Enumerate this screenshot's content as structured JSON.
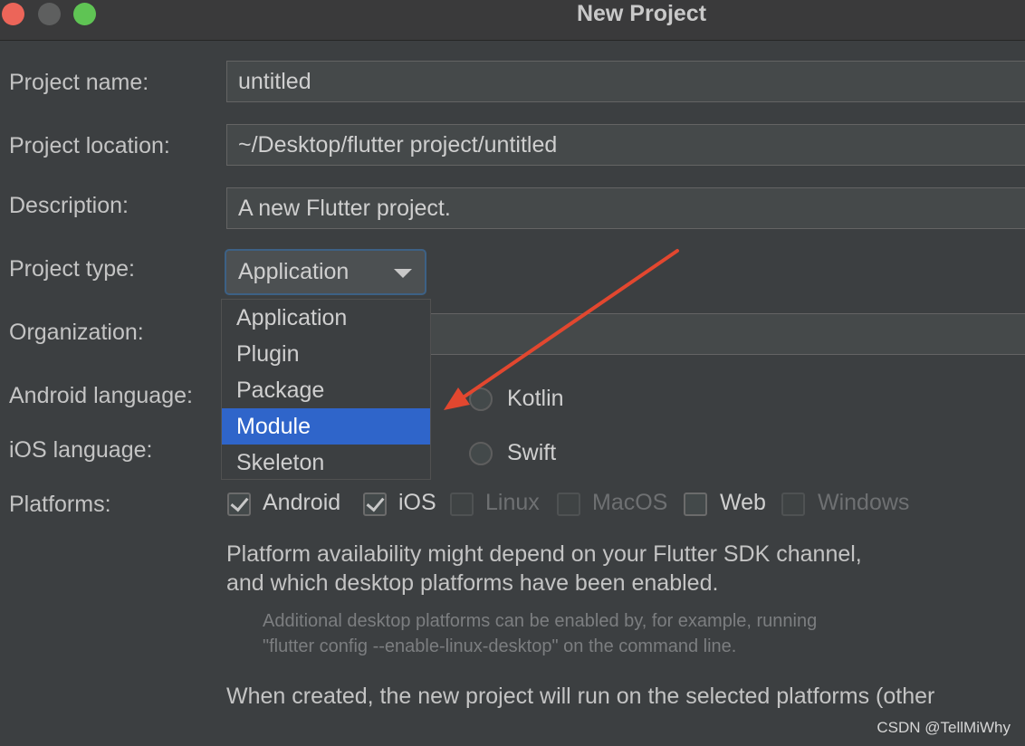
{
  "window": {
    "title": "New Project"
  },
  "form": {
    "project_name": {
      "label": "Project name:",
      "value": "untitled"
    },
    "project_location": {
      "label": "Project location:",
      "value": "~/Desktop/flutter project/untitled"
    },
    "description": {
      "label": "Description:",
      "value": "A new Flutter project."
    },
    "project_type": {
      "label": "Project type:",
      "value": "Application",
      "options": [
        "Application",
        "Plugin",
        "Package",
        "Module",
        "Skeleton"
      ],
      "highlighted": "Module"
    },
    "organization": {
      "label": "Organization:"
    },
    "android_language": {
      "label": "Android language:",
      "option": "Kotlin"
    },
    "ios_language": {
      "label": "iOS language:",
      "option": "Swift"
    },
    "platforms": {
      "label": "Platforms:",
      "items": [
        {
          "name": "Android",
          "checked": true,
          "enabled": true
        },
        {
          "name": "iOS",
          "checked": true,
          "enabled": true
        },
        {
          "name": "Linux",
          "checked": false,
          "enabled": false
        },
        {
          "name": "MacOS",
          "checked": false,
          "enabled": false
        },
        {
          "name": "Web",
          "checked": false,
          "enabled": true
        },
        {
          "name": "Windows",
          "checked": false,
          "enabled": false
        }
      ]
    }
  },
  "info": {
    "line1": "Platform availability might depend on your Flutter SDK channel,",
    "line2": "and which desktop platforms have been enabled.",
    "hint1": "Additional desktop platforms can be enabled by, for example, running",
    "hint2": "\"flutter config --enable-linux-desktop\" on the command line.",
    "line3": "When created, the new project will run on the selected platforms (other"
  },
  "watermark": "CSDN @TellMiWhy",
  "colors": {
    "background": "#3c3f41",
    "selection": "#2f65ca",
    "annotation_arrow": "#e2472f",
    "close": "#ec6559",
    "zoom": "#5fc454"
  }
}
